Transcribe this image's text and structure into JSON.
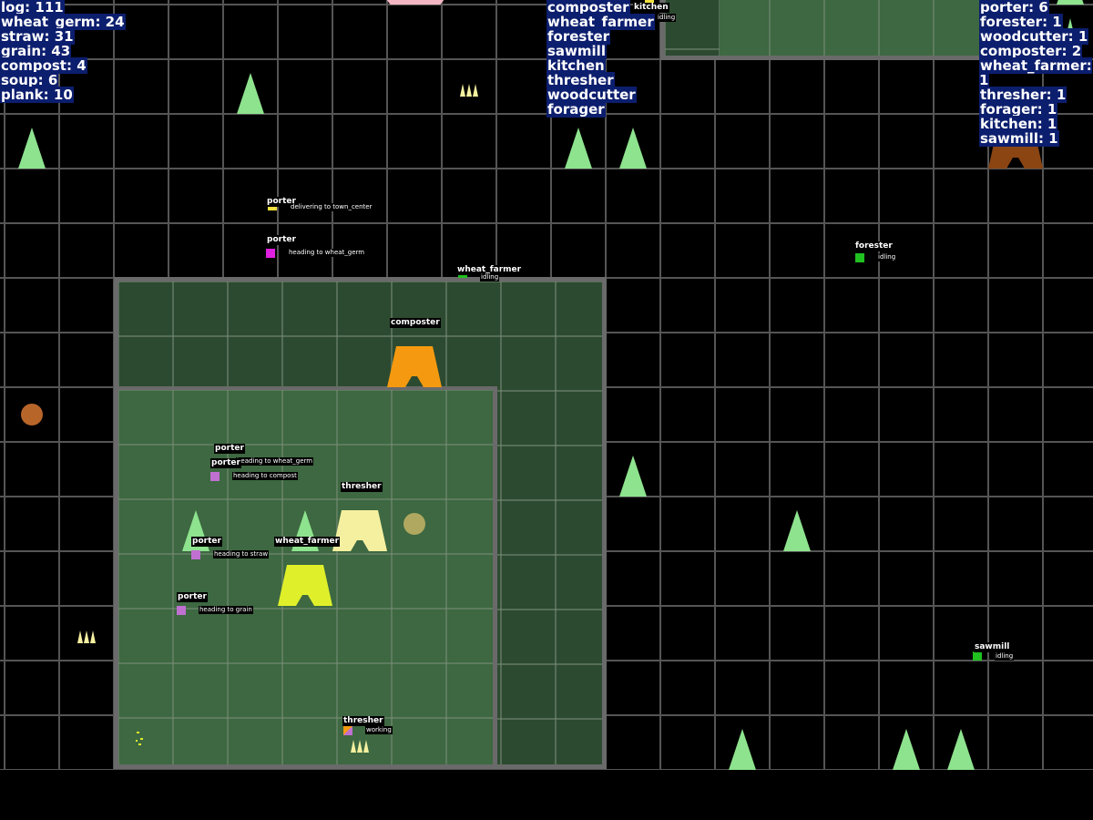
{
  "colors": {
    "tree": "#8ee38e",
    "zone_dark": "#2c4a30",
    "zone_light": "#3d6841",
    "hud_bg": "#0c1e6e",
    "composter": "#f59a10",
    "thresher": "#f5f0a0",
    "wheat_farmer": "#dff02a",
    "sawmill_top": "#8b4513",
    "porter_magenta": "#e020e0",
    "porter_pink": "#c070d0",
    "porter_yellow": "#f0e040",
    "worker_green": "#20c020"
  },
  "resources": [
    "log: 111",
    "wheat_germ: 24",
    "straw: 31",
    "grain: 43",
    "compost: 4",
    "soup: 6",
    "plank: 10"
  ],
  "building_types": [
    "composter",
    "wheat_farmer",
    "forester",
    "sawmill",
    "kitchen",
    "thresher",
    "woodcutter",
    "forager"
  ],
  "worker_counts": [
    "porter: 6",
    "forester: 1",
    "woodcutter: 1",
    "composter: 2",
    "wheat_farmer: 1",
    "thresher: 1",
    "forager: 1",
    "kitchen: 1",
    "sawmill: 1"
  ],
  "buildings": {
    "composter": "composter",
    "thresher": "thresher",
    "wheat_farmer": "wheat_farmer"
  },
  "units": {
    "kitchen": {
      "name": "kitchen",
      "status": "idling"
    },
    "porter1": {
      "name": "porter",
      "status": "delivering to town_center"
    },
    "porter2": {
      "name": "porter",
      "status": "heading to wheat_germ"
    },
    "wheat_farmer": {
      "name": "wheat_farmer",
      "status": "idling"
    },
    "forester": {
      "name": "forester",
      "status": "idling"
    },
    "porter3": {
      "name": "porter",
      "status": "heading to wheat_germ"
    },
    "porter4": {
      "name": "porter",
      "status": "heading to compost"
    },
    "porter5": {
      "name": "porter",
      "status": "heading to straw"
    },
    "porter6": {
      "name": "porter",
      "status": "heading to grain"
    },
    "thresher": {
      "name": "thresher",
      "status": "working"
    },
    "sawmill": {
      "name": "sawmill",
      "status": "idling"
    }
  }
}
